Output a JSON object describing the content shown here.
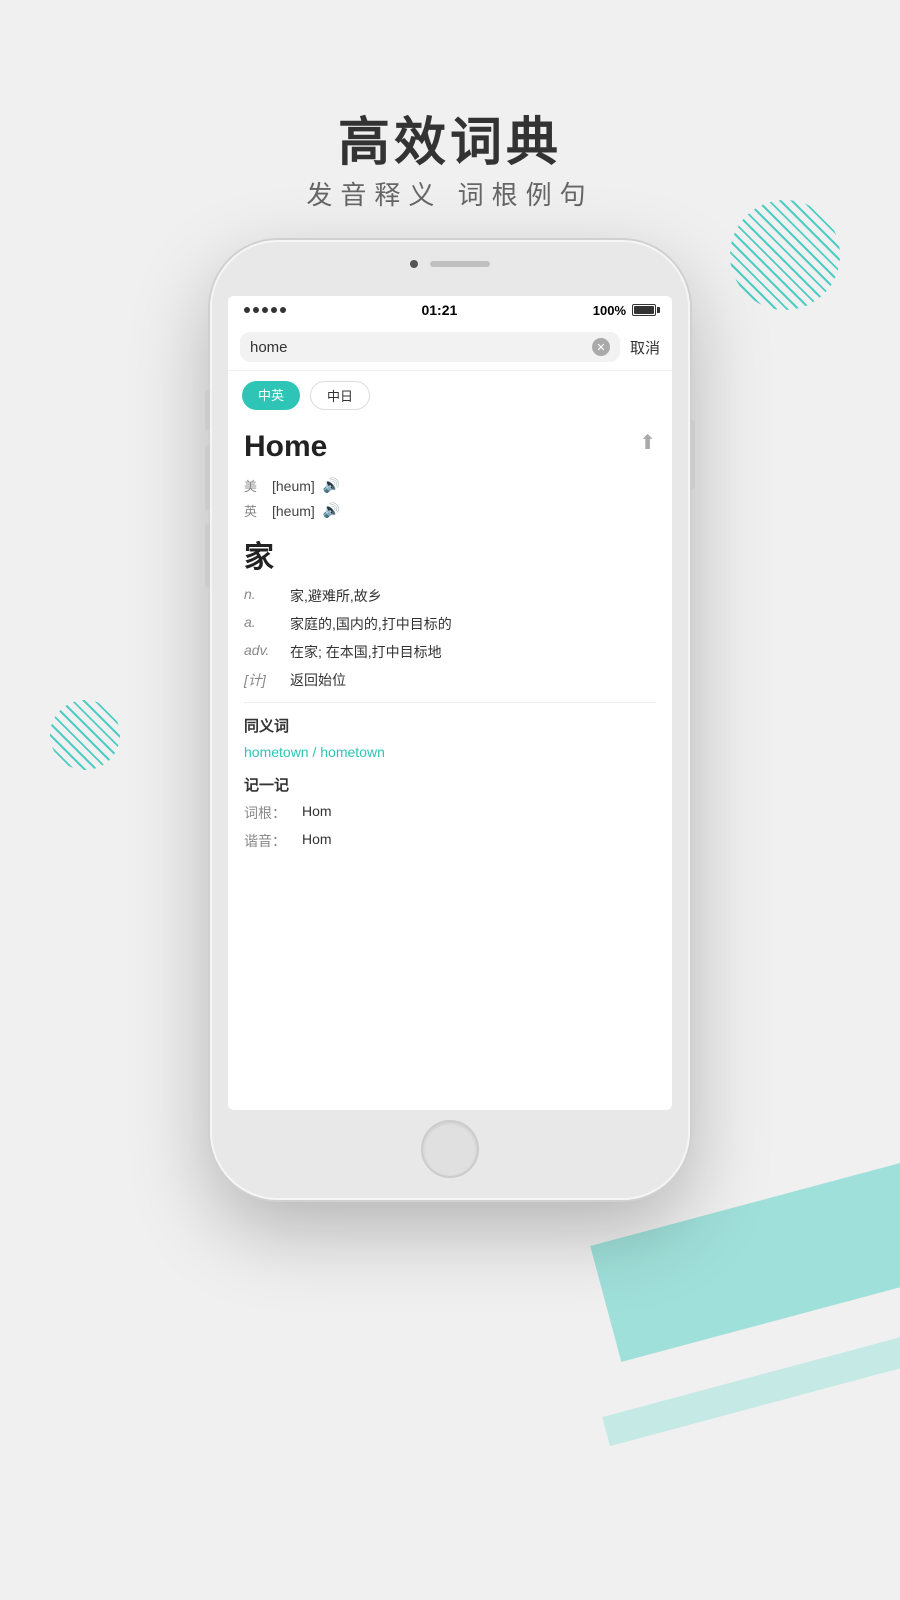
{
  "page": {
    "title": "高效词典",
    "subtitle": "发音释义  词根例句"
  },
  "status_bar": {
    "signal": "•••••",
    "time": "01:21",
    "battery": "100%"
  },
  "search": {
    "query": "home",
    "cancel_label": "取消"
  },
  "lang_tabs": [
    {
      "label": "中英",
      "active": true
    },
    {
      "label": "中日",
      "active": false
    }
  ],
  "word": {
    "title": "Home",
    "pronunciations": [
      {
        "region": "美",
        "ipa": "[heum]",
        "colored": false
      },
      {
        "region": "英",
        "ipa": "[heum]",
        "colored": true
      }
    ],
    "chinese_char": "家",
    "definitions": [
      {
        "pos": "n.",
        "def": "家,避难所,故乡"
      },
      {
        "pos": "a.",
        "def": "家庭的,国内的,打中目标的"
      },
      {
        "pos": "adv.",
        "def": "在家; 在本国,打中目标地"
      },
      {
        "pos": "[计]",
        "def": "返回始位"
      }
    ]
  },
  "synonyms": {
    "title": "同义词",
    "links": "hometown / hometown"
  },
  "memory": {
    "title": "记一记",
    "root_label": "词根：",
    "root_value": "Hom",
    "phonetic_label": "谐音：",
    "phonetic_value": "Hom"
  }
}
